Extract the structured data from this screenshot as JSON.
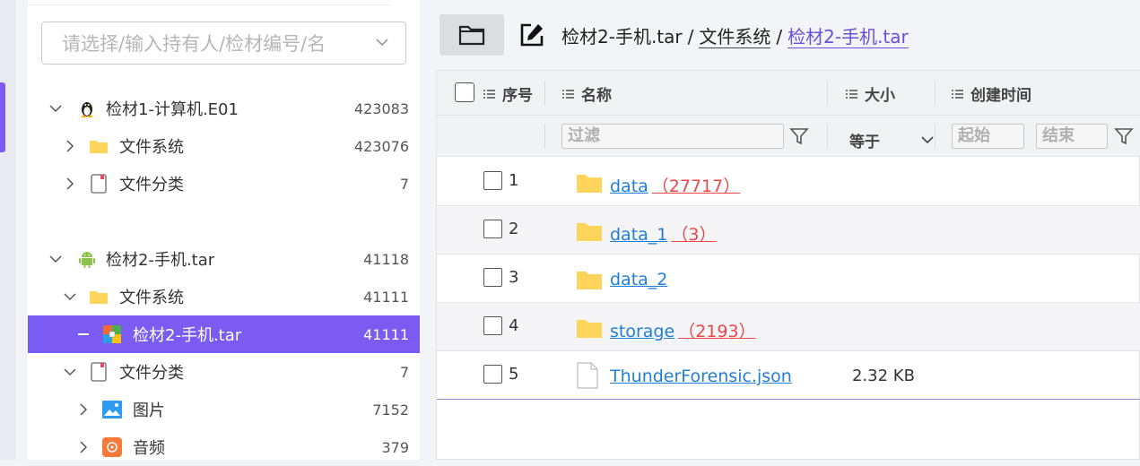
{
  "sidebar": {
    "search_placeholder": "请选择/输入持有人/检材编号/名",
    "tree": [
      {
        "label": "检材1-计算机.E01",
        "count": "423083",
        "icon": "linux-penguin-icon"
      },
      {
        "label": "文件系统",
        "count": "423076",
        "icon": "folder-icon"
      },
      {
        "label": "文件分类",
        "count": "7",
        "icon": "file-category-icon"
      },
      {
        "label": "检材2-手机.tar",
        "count": "41118",
        "icon": "android-icon"
      },
      {
        "label": "文件系统",
        "count": "41111",
        "icon": "folder-icon"
      },
      {
        "label": "检材2-手机.tar",
        "count": "41111",
        "icon": "archive-icon",
        "selected": true
      },
      {
        "label": "文件分类",
        "count": "7",
        "icon": "file-category-icon"
      },
      {
        "label": "图片",
        "count": "7152",
        "icon": "image-icon"
      },
      {
        "label": "音频",
        "count": "379",
        "icon": "audio-icon"
      }
    ]
  },
  "breadcrumb": {
    "root": "检材2-手机.tar",
    "seg1": "文件系统",
    "seg2": "检材2-手机.tar",
    "sep": "/"
  },
  "table": {
    "headers": {
      "index": "序号",
      "name": "名称",
      "size": "大小",
      "created": "创建时间"
    },
    "filters": {
      "name_placeholder": "过滤",
      "size_op": "等于",
      "start_placeholder": "起始",
      "end_placeholder": "结束"
    },
    "rows": [
      {
        "index": "1",
        "name": "data",
        "count": "（27717）",
        "size": "",
        "type": "folder"
      },
      {
        "index": "2",
        "name": "data_1",
        "count": "（3）",
        "size": "",
        "type": "folder"
      },
      {
        "index": "3",
        "name": "data_2",
        "count": "",
        "size": "",
        "type": "folder"
      },
      {
        "index": "4",
        "name": "storage",
        "count": "（2193）",
        "size": "",
        "type": "folder"
      },
      {
        "index": "5",
        "name": "ThunderForensic.json",
        "count": "",
        "size": "2.32 KB",
        "type": "file"
      }
    ]
  },
  "colors": {
    "accent": "#7b5cf2",
    "link": "#1f7fd6",
    "count": "#e9474a",
    "folder": "#ffd45a"
  }
}
